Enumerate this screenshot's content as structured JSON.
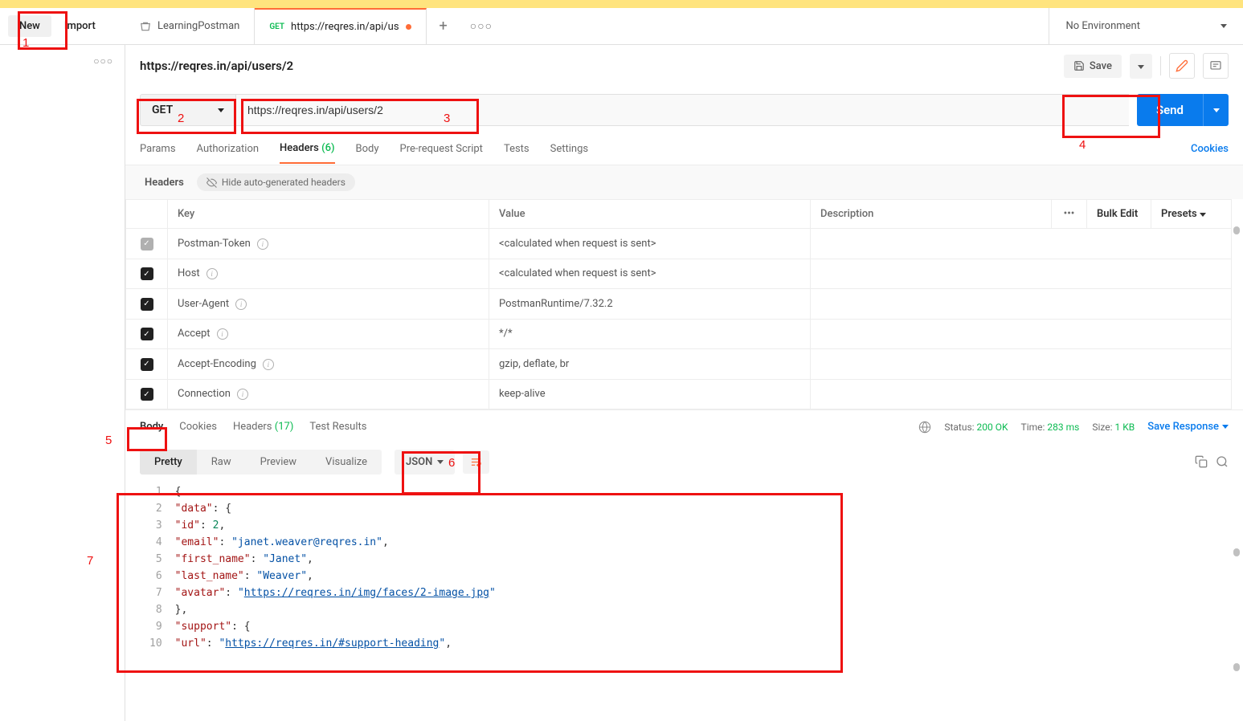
{
  "top": {
    "new": "New",
    "import": "Import",
    "tab_collection": "LearningPostman",
    "tab_req_method": "GET",
    "tab_req_label": "https://reqres.in/api/us",
    "env": "No Environment"
  },
  "request": {
    "title": "https://reqres.in/api/users/2",
    "save": "Save",
    "method": "GET",
    "url": "https://reqres.in/api/users/2",
    "send": "Send",
    "tabs": {
      "params": "Params",
      "auth": "Authorization",
      "headers": "Headers",
      "headers_count": "(6)",
      "body": "Body",
      "prescript": "Pre-request Script",
      "tests": "Tests",
      "settings": "Settings",
      "cookies": "Cookies"
    },
    "headers_sub_label": "Headers",
    "hide_auto": "Hide auto-generated headers",
    "table": {
      "h_key": "Key",
      "h_value": "Value",
      "h_desc": "Description",
      "bulk": "Bulk Edit",
      "presets": "Presets",
      "rows": [
        {
          "key": "Postman-Token",
          "value": "<calculated when request is sent>",
          "checked": "grey"
        },
        {
          "key": "Host",
          "value": "<calculated when request is sent>",
          "checked": "on"
        },
        {
          "key": "User-Agent",
          "value": "PostmanRuntime/7.32.2",
          "checked": "on"
        },
        {
          "key": "Accept",
          "value": "*/*",
          "checked": "on"
        },
        {
          "key": "Accept-Encoding",
          "value": "gzip, deflate, br",
          "checked": "on"
        },
        {
          "key": "Connection",
          "value": "keep-alive",
          "checked": "on"
        }
      ]
    }
  },
  "response": {
    "tabs": {
      "body": "Body",
      "cookies": "Cookies",
      "headers": "Headers",
      "headers_count": "(17)",
      "tests": "Test Results"
    },
    "status_label": "Status:",
    "status_value": "200 OK",
    "time_label": "Time:",
    "time_value": "283 ms",
    "size_label": "Size:",
    "size_value": "1 KB",
    "save_resp": "Save Response",
    "views": {
      "pretty": "Pretty",
      "raw": "Raw",
      "preview": "Preview",
      "visualize": "Visualize"
    },
    "format": "JSON",
    "json_body": {
      "data": {
        "id": 2,
        "email": "janet.weaver@reqres.in",
        "first_name": "Janet",
        "last_name": "Weaver",
        "avatar": "https://reqres.in/img/faces/2-image.jpg"
      },
      "support": {
        "url": "https://reqres.in/#support-heading"
      }
    }
  },
  "annotations": {
    "n1": "1",
    "n2": "2",
    "n3": "3",
    "n4": "4",
    "n5": "5",
    "n6": "6",
    "n7": "7"
  }
}
